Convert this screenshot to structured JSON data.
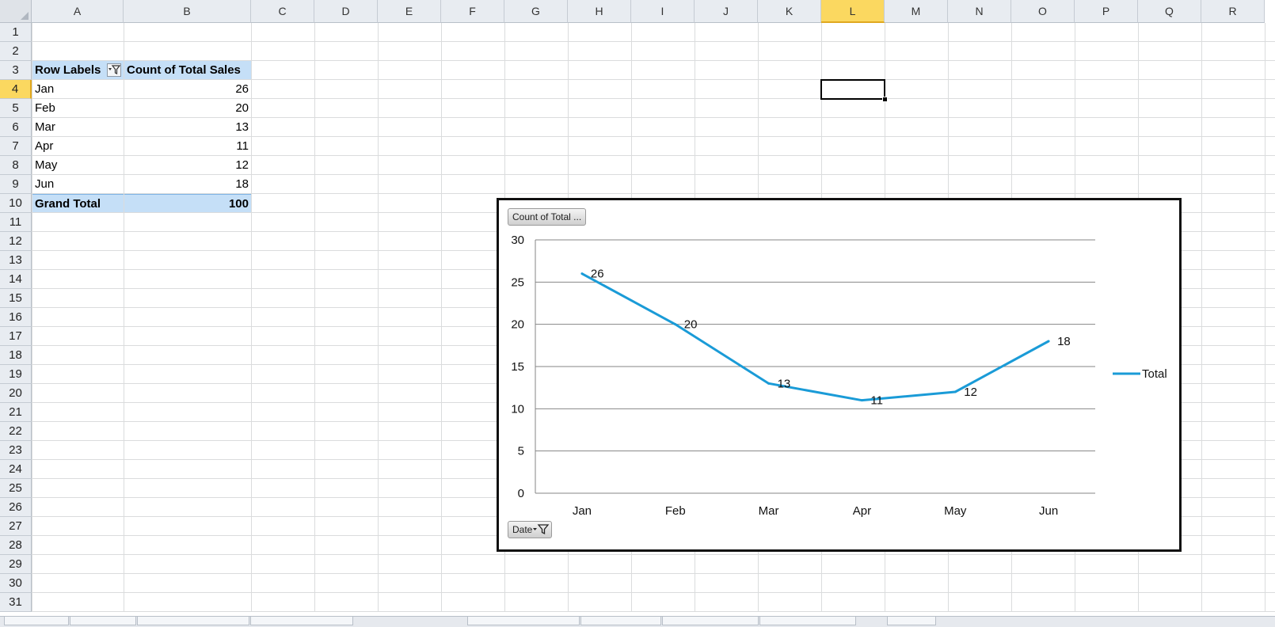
{
  "columns": [
    "A",
    "B",
    "C",
    "D",
    "E",
    "F",
    "G",
    "H",
    "I",
    "J",
    "K",
    "L",
    "M",
    "N",
    "O",
    "P",
    "Q",
    "R"
  ],
  "rows": [
    "1",
    "2",
    "3",
    "4",
    "5",
    "6",
    "7",
    "8",
    "9",
    "10",
    "11",
    "12",
    "13",
    "14",
    "15",
    "16",
    "17",
    "18",
    "19",
    "20",
    "21",
    "22",
    "23",
    "24",
    "25",
    "26",
    "27",
    "28",
    "29",
    "30",
    "31"
  ],
  "selected": {
    "column": "L",
    "row": "4"
  },
  "pivot": {
    "row_labels_header": "Row Labels",
    "value_header": "Count of Total Sales",
    "items": [
      {
        "label": "Jan",
        "value": "26"
      },
      {
        "label": "Feb",
        "value": "20"
      },
      {
        "label": "Mar",
        "value": "13"
      },
      {
        "label": "Apr",
        "value": "11"
      },
      {
        "label": "May",
        "value": "12"
      },
      {
        "label": "Jun",
        "value": "18"
      }
    ],
    "grand_total_label": "Grand Total",
    "grand_total_value": "100"
  },
  "chart": {
    "value_field_button": "Count of Total ...",
    "axis_field_button": "Date",
    "series_color": "#1a9bd7",
    "filter_icon": "funnel-icon"
  },
  "chart_data": {
    "type": "line",
    "categories": [
      "Jan",
      "Feb",
      "Mar",
      "Apr",
      "May",
      "Jun"
    ],
    "series": [
      {
        "name": "Total",
        "values": [
          26,
          20,
          13,
          11,
          12,
          18
        ]
      }
    ],
    "yticks": [
      0,
      5,
      10,
      15,
      20,
      25,
      30
    ],
    "ylim": [
      0,
      30
    ],
    "grid": true,
    "legend": "right",
    "data_labels": true
  }
}
